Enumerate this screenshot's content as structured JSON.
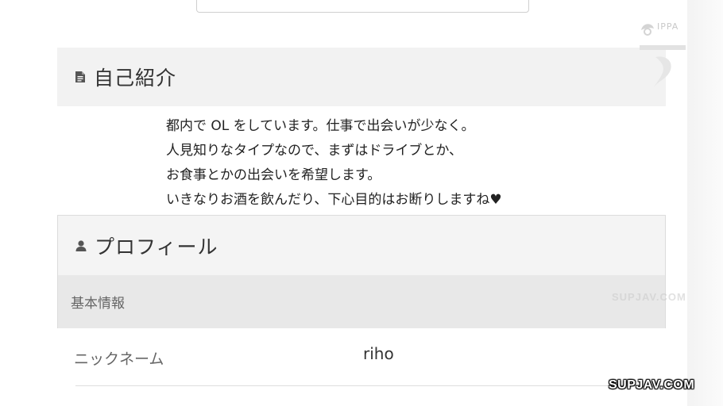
{
  "intro": {
    "title": "自己紹介",
    "icon": "document-icon",
    "lines": [
      "都内で OL をしています。仕事で出会いが少なく。",
      "人見知りなタイプなので、まずはドライブとか、",
      "お食事とかの出会いを希望します。",
      "いきなりお酒を飲んだり、下心目的はお断りしますね♥"
    ]
  },
  "profile": {
    "title": "プロフィール",
    "icon": "person-icon",
    "basic_info_label": "基本情報",
    "rows": [
      {
        "label": "ニックネーム",
        "value": "riho"
      }
    ]
  },
  "watermarks": {
    "logo_text": "IPPA",
    "mid": "SUPJAV.COM",
    "bottom": "SUPJAV.COM"
  },
  "colors": {
    "header_bg": "#f2f2f2",
    "basic_info_bg": "#e8e8e8",
    "text": "#222222",
    "muted_text": "#666666"
  }
}
